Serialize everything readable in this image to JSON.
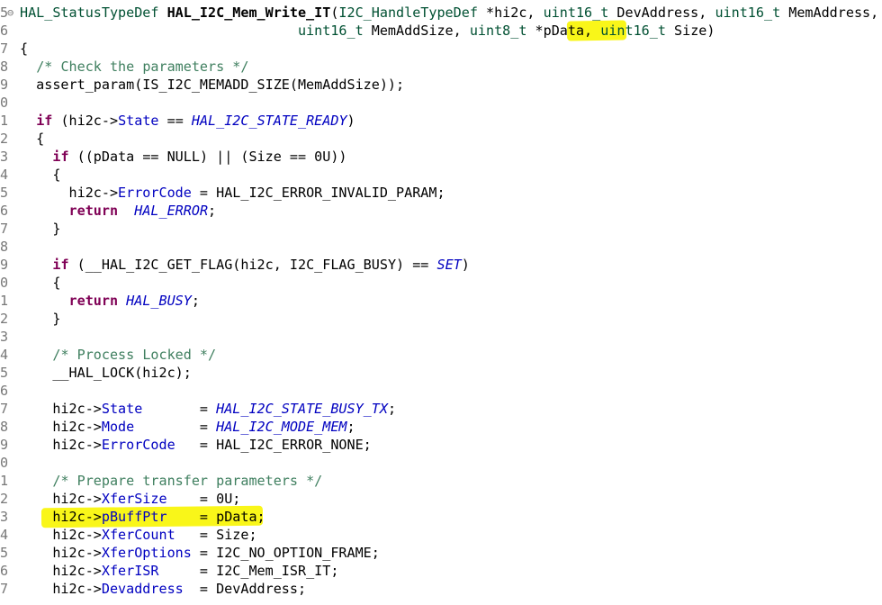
{
  "editor": {
    "lines": [
      {
        "num": "5",
        "fold": "⊖",
        "tokens": [
          {
            "t": "HAL_StatusTypeDef ",
            "c": "type"
          },
          {
            "t": "HAL_I2C_Mem_Write_IT",
            "c": "fn"
          },
          {
            "t": "(",
            "c": "plain"
          },
          {
            "t": "I2C_HandleTypeDef",
            "c": "type"
          },
          {
            "t": " *hi2c, ",
            "c": "plain"
          },
          {
            "t": "uint16_t",
            "c": "type"
          },
          {
            "t": " DevAddress, ",
            "c": "plain"
          },
          {
            "t": "uint16_t",
            "c": "type"
          },
          {
            "t": " MemAddress,",
            "c": "plain"
          }
        ]
      },
      {
        "num": "6",
        "fold": "",
        "tokens": [
          {
            "t": "                                  ",
            "c": "plain"
          },
          {
            "t": "uint16_t",
            "c": "type"
          },
          {
            "t": " MemAddSize, ",
            "c": "plain"
          },
          {
            "t": "uint8_t",
            "c": "type"
          },
          {
            "t": " *pData, ",
            "c": "plain"
          },
          {
            "t": "uint16_t",
            "c": "type"
          },
          {
            "t": " Size)",
            "c": "plain"
          }
        ]
      },
      {
        "num": "7",
        "fold": "",
        "tokens": [
          {
            "t": "{",
            "c": "plain"
          }
        ]
      },
      {
        "num": "8",
        "fold": "",
        "tokens": [
          {
            "t": "  ",
            "c": "plain"
          },
          {
            "t": "/* Check the parameters */",
            "c": "comment"
          }
        ]
      },
      {
        "num": "9",
        "fold": "",
        "tokens": [
          {
            "t": "  assert_param(IS_I2C_MEMADD_SIZE(MemAddSize));",
            "c": "plain"
          }
        ]
      },
      {
        "num": "0",
        "fold": "",
        "tokens": []
      },
      {
        "num": "1",
        "fold": "",
        "tokens": [
          {
            "t": "  ",
            "c": "plain"
          },
          {
            "t": "if",
            "c": "kw"
          },
          {
            "t": " (hi2c->",
            "c": "plain"
          },
          {
            "t": "State",
            "c": "field"
          },
          {
            "t": " == ",
            "c": "plain"
          },
          {
            "t": "HAL_I2C_STATE_READY",
            "c": "macro"
          },
          {
            "t": ")",
            "c": "plain"
          }
        ]
      },
      {
        "num": "2",
        "fold": "",
        "tokens": [
          {
            "t": "  {",
            "c": "plain"
          }
        ]
      },
      {
        "num": "3",
        "fold": "",
        "tokens": [
          {
            "t": "    ",
            "c": "plain"
          },
          {
            "t": "if",
            "c": "kw"
          },
          {
            "t": " ((pData == NULL) || (Size == 0U))",
            "c": "plain"
          }
        ]
      },
      {
        "num": "4",
        "fold": "",
        "tokens": [
          {
            "t": "    {",
            "c": "plain"
          }
        ]
      },
      {
        "num": "5",
        "fold": "",
        "tokens": [
          {
            "t": "      hi2c->",
            "c": "plain"
          },
          {
            "t": "ErrorCode",
            "c": "field"
          },
          {
            "t": " = HAL_I2C_ERROR_INVALID_PARAM;",
            "c": "plain"
          }
        ]
      },
      {
        "num": "6",
        "fold": "",
        "tokens": [
          {
            "t": "      ",
            "c": "plain"
          },
          {
            "t": "return",
            "c": "kw"
          },
          {
            "t": "  ",
            "c": "plain"
          },
          {
            "t": "HAL_ERROR",
            "c": "macro"
          },
          {
            "t": ";",
            "c": "plain"
          }
        ]
      },
      {
        "num": "7",
        "fold": "",
        "tokens": [
          {
            "t": "    }",
            "c": "plain"
          }
        ]
      },
      {
        "num": "8",
        "fold": "",
        "tokens": []
      },
      {
        "num": "9",
        "fold": "",
        "tokens": [
          {
            "t": "    ",
            "c": "plain"
          },
          {
            "t": "if",
            "c": "kw"
          },
          {
            "t": " (__HAL_I2C_GET_FLAG(hi2c, I2C_FLAG_BUSY) == ",
            "c": "plain"
          },
          {
            "t": "SET",
            "c": "macro"
          },
          {
            "t": ")",
            "c": "plain"
          }
        ]
      },
      {
        "num": "0",
        "fold": "",
        "tokens": [
          {
            "t": "    {",
            "c": "plain"
          }
        ]
      },
      {
        "num": "1",
        "fold": "",
        "tokens": [
          {
            "t": "      ",
            "c": "plain"
          },
          {
            "t": "return",
            "c": "kw"
          },
          {
            "t": " ",
            "c": "plain"
          },
          {
            "t": "HAL_BUSY",
            "c": "macro"
          },
          {
            "t": ";",
            "c": "plain"
          }
        ]
      },
      {
        "num": "2",
        "fold": "",
        "tokens": [
          {
            "t": "    }",
            "c": "plain"
          }
        ]
      },
      {
        "num": "3",
        "fold": "",
        "tokens": []
      },
      {
        "num": "4",
        "fold": "",
        "tokens": [
          {
            "t": "    ",
            "c": "plain"
          },
          {
            "t": "/* Process Locked */",
            "c": "comment"
          }
        ]
      },
      {
        "num": "5",
        "fold": "",
        "tokens": [
          {
            "t": "    __HAL_LOCK(hi2c);",
            "c": "plain"
          }
        ]
      },
      {
        "num": "6",
        "fold": "",
        "tokens": []
      },
      {
        "num": "7",
        "fold": "",
        "tokens": [
          {
            "t": "    hi2c->",
            "c": "plain"
          },
          {
            "t": "State",
            "c": "field"
          },
          {
            "t": "       = ",
            "c": "plain"
          },
          {
            "t": "HAL_I2C_STATE_BUSY_TX",
            "c": "macro"
          },
          {
            "t": ";",
            "c": "plain"
          }
        ]
      },
      {
        "num": "8",
        "fold": "",
        "tokens": [
          {
            "t": "    hi2c->",
            "c": "plain"
          },
          {
            "t": "Mode",
            "c": "field"
          },
          {
            "t": "        = ",
            "c": "plain"
          },
          {
            "t": "HAL_I2C_MODE_MEM",
            "c": "macro"
          },
          {
            "t": ";",
            "c": "plain"
          }
        ]
      },
      {
        "num": "9",
        "fold": "",
        "tokens": [
          {
            "t": "    hi2c->",
            "c": "plain"
          },
          {
            "t": "ErrorCode",
            "c": "field"
          },
          {
            "t": "   = HAL_I2C_ERROR_NONE;",
            "c": "plain"
          }
        ]
      },
      {
        "num": "0",
        "fold": "",
        "tokens": []
      },
      {
        "num": "1",
        "fold": "",
        "tokens": [
          {
            "t": "    ",
            "c": "plain"
          },
          {
            "t": "/* Prepare transfer parameters */",
            "c": "comment"
          }
        ]
      },
      {
        "num": "2",
        "fold": "",
        "tokens": [
          {
            "t": "    hi2c->",
            "c": "plain"
          },
          {
            "t": "XferSize",
            "c": "field"
          },
          {
            "t": "    = 0U;",
            "c": "plain"
          }
        ]
      },
      {
        "num": "3",
        "fold": "",
        "tokens": [
          {
            "t": "    hi2c->",
            "c": "plain"
          },
          {
            "t": "pBuffPtr",
            "c": "field"
          },
          {
            "t": "    = pData;",
            "c": "plain"
          }
        ]
      },
      {
        "num": "4",
        "fold": "",
        "tokens": [
          {
            "t": "    hi2c->",
            "c": "plain"
          },
          {
            "t": "XferCount",
            "c": "field"
          },
          {
            "t": "   = Size;",
            "c": "plain"
          }
        ]
      },
      {
        "num": "5",
        "fold": "",
        "tokens": [
          {
            "t": "    hi2c->",
            "c": "plain"
          },
          {
            "t": "XferOptions",
            "c": "field"
          },
          {
            "t": " = I2C_NO_OPTION_FRAME;",
            "c": "plain"
          }
        ]
      },
      {
        "num": "6",
        "fold": "",
        "tokens": [
          {
            "t": "    hi2c->",
            "c": "plain"
          },
          {
            "t": "XferISR",
            "c": "field"
          },
          {
            "t": "     = I2C_Mem_ISR_IT;",
            "c": "plain"
          }
        ]
      },
      {
        "num": "7",
        "fold": "",
        "tokens": [
          {
            "t": "    hi2c->",
            "c": "plain"
          },
          {
            "t": "Devaddress",
            "c": "field"
          },
          {
            "t": "  = DevAddress;",
            "c": "plain"
          }
        ]
      }
    ]
  },
  "colors": {
    "comment": "#3f7f5f",
    "keyword": "#7f0055",
    "type": "#005032",
    "field": "#0000c0",
    "macro": "#0000c0",
    "highlight": "#f8f500"
  }
}
